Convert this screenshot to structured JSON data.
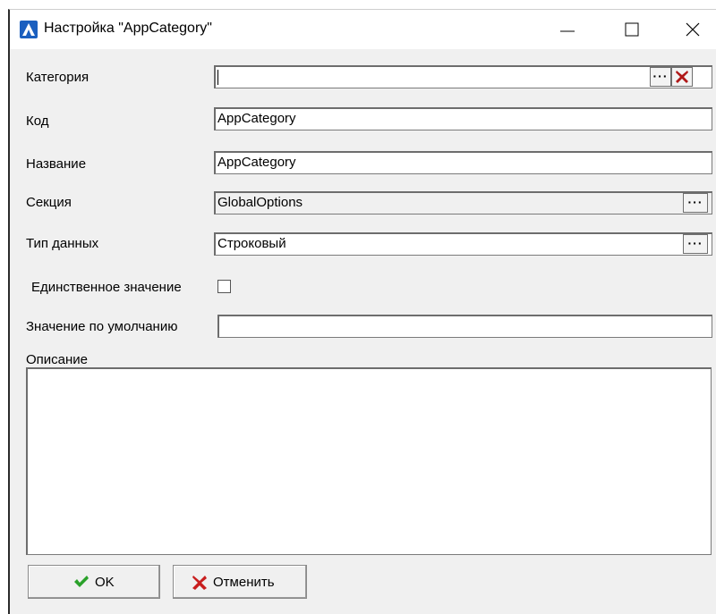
{
  "window": {
    "title": "Настройка \"AppCategory\"",
    "controls": [
      "minimize-icon",
      "maximize-icon",
      "close-icon"
    ]
  },
  "form": {
    "category": {
      "label": "Категория",
      "value": ""
    },
    "code": {
      "label": "Код",
      "value": "AppCategory"
    },
    "name": {
      "label": "Название",
      "value": "AppCategory"
    },
    "section": {
      "label": "Секция",
      "value": "GlobalOptions"
    },
    "data_type": {
      "label": "Тип данных",
      "value": "Строковый"
    },
    "single_value": {
      "label": "Единственное значение",
      "checked": false
    },
    "default_value": {
      "label": "Значение по умолчанию",
      "value": ""
    },
    "description": {
      "label": "Описание",
      "value": ""
    },
    "browse_label": "···"
  },
  "buttons": {
    "ok_label": "OK",
    "cancel_label": "Отменить"
  },
  "colors": {
    "ok_icon": "#2aa12a",
    "cancel_icon": "#c81e1e",
    "clear_icon": "#b01818",
    "app_icon": "#1b5fbf"
  }
}
